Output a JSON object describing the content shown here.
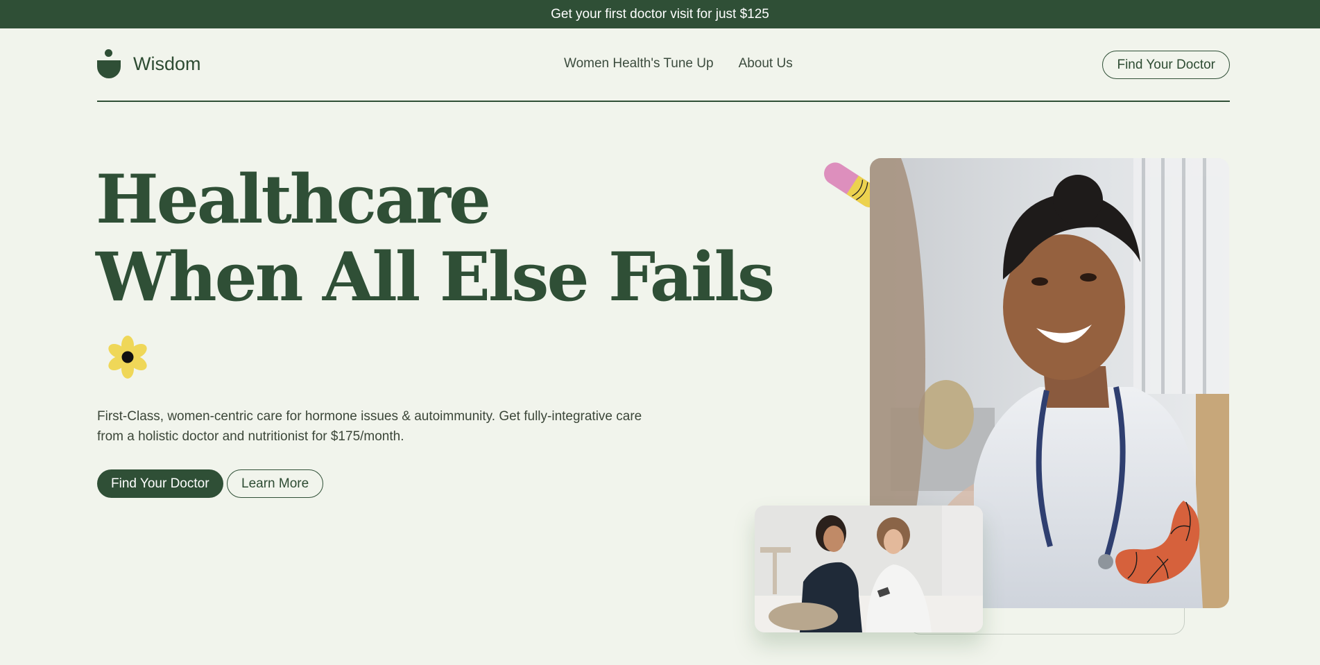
{
  "announcement": {
    "text": "Get your first doctor visit for just $125"
  },
  "brand": {
    "name": "Wisdom"
  },
  "nav": {
    "links": [
      "Women Health's Tune Up",
      "About Us"
    ],
    "cta": "Find Your Doctor"
  },
  "hero": {
    "title_line1": "Healthcare",
    "title_line2": "When All Else Fails",
    "description": "First-Class, women-centric care for hormone issues & autoimmunity. Get fully-integrative care from a holistic doctor and nutritionist for $175/month.",
    "primary_button": "Find Your Doctor",
    "secondary_button": "Learn More"
  },
  "colors": {
    "brand_green": "#2f4f36",
    "background": "#f1f4ec",
    "flower_yellow": "#efd758",
    "pill_pink": "#dd8fbd",
    "squiggle_orange": "#d6613c"
  },
  "icons": [
    "wisdom-logo-icon",
    "flower-icon",
    "pill-decoration-icon",
    "squiggle-decoration-icon"
  ]
}
